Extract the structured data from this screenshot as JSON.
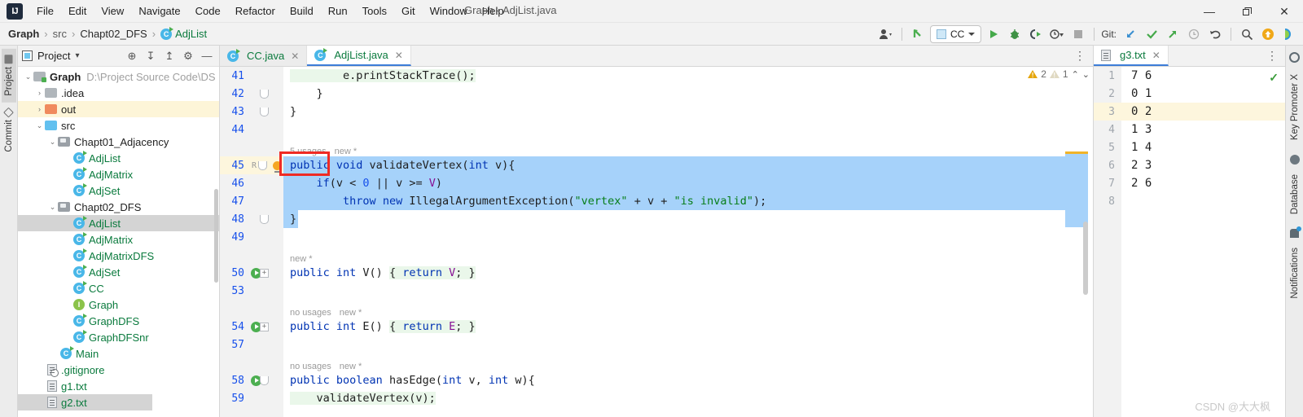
{
  "window": {
    "title": "Graph - AdjList.java",
    "controls": {
      "minimize": "—",
      "maximize": "❐",
      "close": "✕"
    },
    "logo": "IJ"
  },
  "menu": {
    "items": [
      {
        "label": "File"
      },
      {
        "label": "Edit"
      },
      {
        "label": "View"
      },
      {
        "label": "Navigate"
      },
      {
        "label": "Code"
      },
      {
        "label": "Refactor"
      },
      {
        "label": "Build"
      },
      {
        "label": "Run"
      },
      {
        "label": "Tools"
      },
      {
        "label": "Git"
      },
      {
        "label": "Window"
      },
      {
        "label": "Help"
      }
    ]
  },
  "breadcrumb": {
    "separator": "›",
    "items": [
      {
        "label": "Graph",
        "style": "bold"
      },
      {
        "label": "src",
        "style": "dim"
      },
      {
        "label": "Chapt02_DFS",
        "style": "dim"
      },
      {
        "label": "AdjList",
        "style": "green",
        "icon": "java-class-icon"
      }
    ]
  },
  "toolbar": {
    "account_icon": "user-account-icon",
    "update_icon": "green-arrow-up-icon",
    "run_config": {
      "label": "CC",
      "icon": "run-config-icon",
      "caret": "▾"
    },
    "run_icon": "run-play-icon",
    "debug_icon": "debug-bug-icon",
    "run_coverage_icon": "run-with-coverage-icon",
    "profiler_icon": "profiler-icon",
    "stop_icon": "stop-square-icon",
    "git_label": "Git:",
    "git_update_icon": "git-update-arrow-icon",
    "git_commit_icon": "git-commit-check-icon",
    "git_push_icon": "git-push-arrow-icon",
    "git_history_icon": "git-history-clock-icon",
    "git_rollback_icon": "git-rollback-icon",
    "search_icon": "search-magnifier-icon",
    "notify_icon": "update-badge-icon",
    "ide_icon": "ide-helper-icon"
  },
  "left_strip": {
    "tabs": [
      {
        "label": "Project",
        "icon": "project-folder-icon",
        "active": true
      },
      {
        "label": "Commit",
        "icon": "commit-diamond-icon",
        "active": false
      }
    ]
  },
  "project_panel": {
    "title": "Project",
    "caret": "▾",
    "icons": [
      {
        "name": "locate-target-icon",
        "glyph": "⊕"
      },
      {
        "name": "expand-all-icon",
        "glyph": "↧"
      },
      {
        "name": "collapse-all-icon",
        "glyph": "↥"
      },
      {
        "name": "settings-gear-icon",
        "glyph": "⚙"
      },
      {
        "name": "hide-panel-icon",
        "glyph": "—"
      }
    ],
    "tree": [
      {
        "label": "Graph",
        "path": "D:\\Project Source Code\\DS",
        "indent": 0,
        "arrow": "⌄",
        "icon": "module-folder-icon",
        "style": "bold"
      },
      {
        "label": ".idea",
        "indent": 1,
        "arrow": "›",
        "icon": "folder-icon",
        "style": "dark"
      },
      {
        "label": "out",
        "indent": 1,
        "arrow": "›",
        "icon": "out-folder-icon",
        "style": "dark",
        "highlight": true
      },
      {
        "label": "src",
        "indent": 1,
        "arrow": "⌄",
        "icon": "source-folder-icon",
        "style": "dark"
      },
      {
        "label": "Chapt01_Adjacency",
        "indent": 2,
        "arrow": "⌄",
        "icon": "package-icon",
        "style": "dark"
      },
      {
        "label": "AdjList",
        "indent": 3,
        "icon": "java-class-icon",
        "style": "green"
      },
      {
        "label": "AdjMatrix",
        "indent": 3,
        "icon": "java-class-icon",
        "style": "green"
      },
      {
        "label": "AdjSet",
        "indent": 3,
        "icon": "java-class-icon",
        "style": "green"
      },
      {
        "label": "Chapt02_DFS",
        "indent": 2,
        "arrow": "⌄",
        "icon": "package-icon",
        "style": "dark"
      },
      {
        "label": "AdjList",
        "indent": 3,
        "icon": "java-class-icon",
        "style": "green",
        "selected": true
      },
      {
        "label": "AdjMatrix",
        "indent": 3,
        "icon": "java-class-icon",
        "style": "green"
      },
      {
        "label": "AdjMatrixDFS",
        "indent": 3,
        "icon": "java-class-icon",
        "style": "green"
      },
      {
        "label": "AdjSet",
        "indent": 3,
        "icon": "java-class-icon",
        "style": "green"
      },
      {
        "label": "CC",
        "indent": 3,
        "icon": "java-class-icon",
        "style": "green"
      },
      {
        "label": "Graph",
        "indent": 3,
        "icon": "java-interface-icon",
        "style": "green"
      },
      {
        "label": "GraphDFS",
        "indent": 3,
        "icon": "java-class-icon",
        "style": "green"
      },
      {
        "label": "GraphDFSnr",
        "indent": 3,
        "icon": "java-class-icon",
        "style": "green"
      },
      {
        "label": "Main",
        "indent": 2,
        "icon": "java-class-icon",
        "style": "green"
      },
      {
        "label": ".gitignore",
        "indent": 1,
        "icon": "gitignore-file-icon",
        "style": "green"
      },
      {
        "label": "g1.txt",
        "indent": 1,
        "icon": "text-file-icon",
        "style": "green"
      },
      {
        "label": "g2.txt",
        "indent": 1,
        "icon": "text-file-icon",
        "style": "green",
        "selected": true
      }
    ]
  },
  "editor": {
    "tabs": [
      {
        "label": "CC.java",
        "icon": "java-class-icon",
        "active": false,
        "close": "✕"
      },
      {
        "label": "AdjList.java",
        "icon": "java-class-icon",
        "active": true,
        "close": "✕"
      }
    ],
    "more_icon": "editor-options-icon",
    "warnings": {
      "error_count": "2",
      "weak_count": "1",
      "up_icon": "⌃",
      "down_icon": "⌄"
    },
    "lines": [
      {
        "num": "41",
        "segments": [
          {
            "t": "        e.printStackTrace();",
            "c": "typ"
          }
        ]
      },
      {
        "num": "42",
        "fold": "round",
        "segments": [
          {
            "t": "    }",
            "c": "typ"
          }
        ]
      },
      {
        "num": "43",
        "fold": "round",
        "segments": [
          {
            "t": "}",
            "c": "typ"
          }
        ]
      },
      {
        "num": "44",
        "segments": []
      },
      {
        "num": "",
        "hint": [
          "5 usages",
          "new *"
        ]
      },
      {
        "num": "45",
        "marker": "bulb",
        "mk_r": "R",
        "fold": "round",
        "selected": true,
        "segments": [
          {
            "t": "public ",
            "c": "kw"
          },
          {
            "t": "void ",
            "c": "kw"
          },
          {
            "t": "validateVertex(",
            "c": "typ"
          },
          {
            "t": "int ",
            "c": "kw"
          },
          {
            "t": "v){",
            "c": "typ"
          }
        ]
      },
      {
        "num": "46",
        "selected": true,
        "segments": [
          {
            "t": "    ",
            "c": "typ"
          },
          {
            "t": "if",
            "c": "kw"
          },
          {
            "t": "(v < ",
            "c": "typ"
          },
          {
            "t": "0",
            "c": "num"
          },
          {
            "t": " || v >= ",
            "c": "typ"
          },
          {
            "t": "V",
            "c": "fld"
          },
          {
            "t": ")",
            "c": "typ"
          }
        ]
      },
      {
        "num": "47",
        "selected": true,
        "segments": [
          {
            "t": "        ",
            "c": "typ"
          },
          {
            "t": "throw ",
            "c": "kw"
          },
          {
            "t": "new ",
            "c": "kw"
          },
          {
            "t": "IllegalArgumentException(",
            "c": "typ"
          },
          {
            "t": "\"vertex\"",
            "c": "str"
          },
          {
            "t": " + v + ",
            "c": "typ"
          },
          {
            "t": "\"is invalid\"",
            "c": "str"
          },
          {
            "t": ");",
            "c": "typ"
          }
        ]
      },
      {
        "num": "48",
        "fold": "round",
        "selected": true,
        "segments": [
          {
            "t": "}",
            "c": "typ"
          }
        ]
      },
      {
        "num": "49",
        "segments": []
      },
      {
        "num": "",
        "hint": [
          "new *"
        ]
      },
      {
        "num": "50",
        "marker": "run",
        "fold": "plus",
        "segments": [
          {
            "t": "public ",
            "c": "kw"
          },
          {
            "t": "int ",
            "c": "kw"
          },
          {
            "t": "V() ",
            "c": "typ"
          },
          {
            "t": "{ ",
            "c": "typ"
          },
          {
            "t": "return ",
            "c": "kw"
          },
          {
            "t": "V",
            "c": "fld"
          },
          {
            "t": "; }",
            "c": "typ"
          }
        ]
      },
      {
        "num": "53",
        "segments": []
      },
      {
        "num": "",
        "hint": [
          "no usages",
          "new *"
        ]
      },
      {
        "num": "54",
        "marker": "run",
        "fold": "plus",
        "segments": [
          {
            "t": "public ",
            "c": "kw"
          },
          {
            "t": "int ",
            "c": "kw"
          },
          {
            "t": "E() ",
            "c": "typ"
          },
          {
            "t": "{ ",
            "c": "typ"
          },
          {
            "t": "return ",
            "c": "kw"
          },
          {
            "t": "E",
            "c": "fld"
          },
          {
            "t": "; }",
            "c": "typ"
          }
        ]
      },
      {
        "num": "57",
        "segments": []
      },
      {
        "num": "",
        "hint": [
          "no usages",
          "new *"
        ]
      },
      {
        "num": "58",
        "marker": "run",
        "fold": "round",
        "segments": [
          {
            "t": "public ",
            "c": "kw"
          },
          {
            "t": "boolean ",
            "c": "kw"
          },
          {
            "t": "hasEdge(",
            "c": "typ"
          },
          {
            "t": "int ",
            "c": "kw"
          },
          {
            "t": "v, ",
            "c": "typ"
          },
          {
            "t": "int ",
            "c": "kw"
          },
          {
            "t": "w){",
            "c": "typ"
          }
        ]
      },
      {
        "num": "59",
        "segments": [
          {
            "t": "    validateVertex(v);",
            "c": "typ"
          }
        ]
      }
    ]
  },
  "right_editor": {
    "tab": {
      "label": "g3.txt",
      "icon": "text-file-icon",
      "close": "✕"
    },
    "more_icon": "editor-options-icon",
    "ok_icon": "inspection-ok-check",
    "lines": [
      {
        "num": "1",
        "text": "7 6"
      },
      {
        "num": "2",
        "text": "0 1"
      },
      {
        "num": "3",
        "text": "0 2",
        "current": true
      },
      {
        "num": "4",
        "text": "1 3"
      },
      {
        "num": "5",
        "text": "1 4"
      },
      {
        "num": "6",
        "text": "2 3"
      },
      {
        "num": "7",
        "text": "2 6"
      },
      {
        "num": "8",
        "text": ""
      }
    ]
  },
  "right_strip": {
    "tabs": [
      {
        "label": "Key Promoter X",
        "icon": "key-promoter-icon"
      },
      {
        "label": "Database",
        "icon": "database-icon"
      },
      {
        "label": "Notifications",
        "icon": "notifications-bell-icon"
      }
    ]
  },
  "watermark": "CSDN @大大枫",
  "colors": {
    "accent": "#3d7dd8",
    "selection": "#a6d2fa",
    "keyword": "#0033b3",
    "string": "#067d17",
    "field": "#871094",
    "number": "#1750eb",
    "green_text": "#0a7a3d",
    "highlight_row": "#fdf6dd",
    "annotation_box": "#ef2b24"
  }
}
